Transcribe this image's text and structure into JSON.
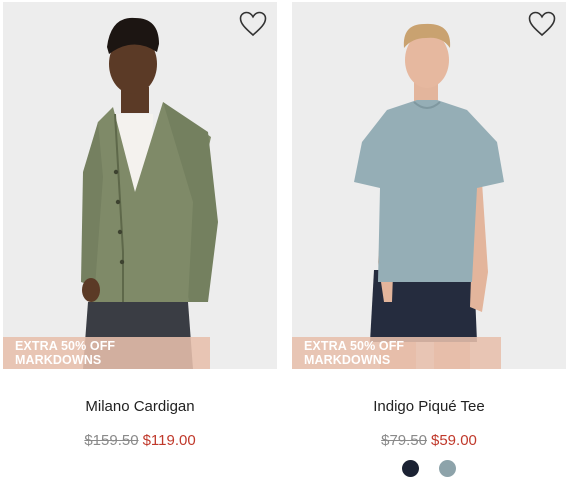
{
  "products": [
    {
      "name": "Milano Cardigan",
      "badge": "EXTRA 50% OFF MARKDOWNS",
      "original_price": "$159.50",
      "sale_price": "$119.00",
      "swatches": []
    },
    {
      "name": "Indigo Piqué Tee",
      "badge": "EXTRA 50% OFF MARKDOWNS",
      "original_price": "$79.50",
      "sale_price": "$59.00",
      "swatches": [
        {
          "name": "navy",
          "color": "#1b2233"
        },
        {
          "name": "blue-grey",
          "color": "#8da3aa"
        }
      ]
    }
  ],
  "colors": {
    "sale": "#c0392b",
    "strike": "#8a8a8a",
    "badge_bg": "#e7bfac"
  },
  "icons": {
    "favorite": "heart-outline-icon"
  }
}
